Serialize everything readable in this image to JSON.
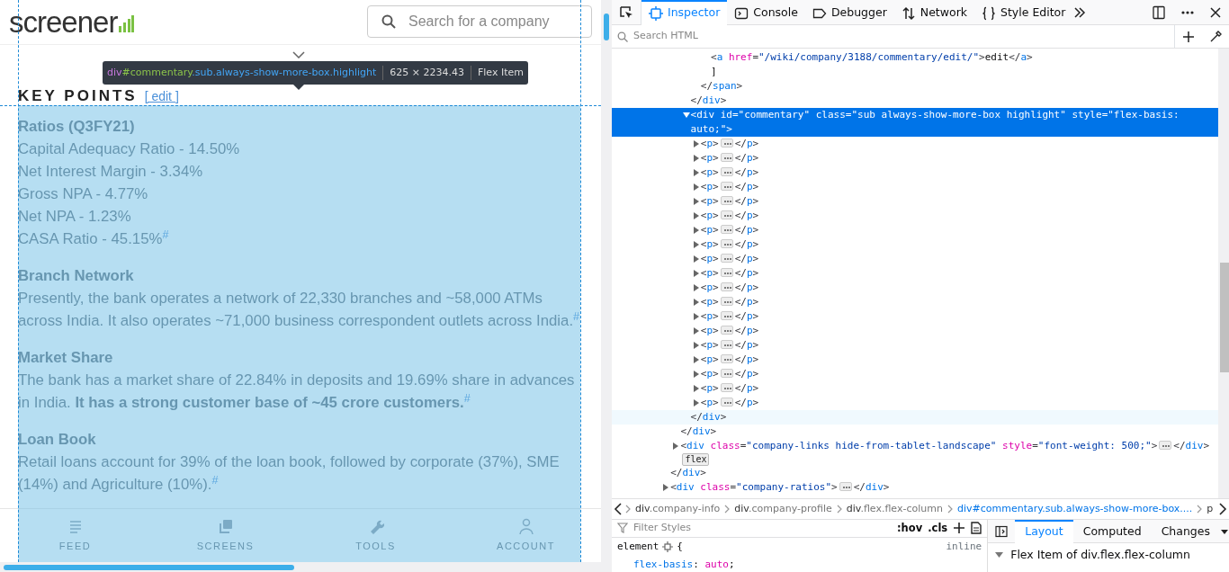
{
  "page": {
    "logo": "screener",
    "search": {
      "placeholder": "Search for a company"
    },
    "key_points": {
      "title": "KEY POINTS",
      "edit_link": "[ edit ]"
    },
    "sections": [
      {
        "heading": "Ratios (Q3FY21)",
        "lines": [
          "Capital Adequacy Ratio - 14.50%",
          "Net Interest Margin - 3.34%",
          "Gross NPA - 4.77%",
          "Net NPA - 1.23%",
          "CASA Ratio - 45.15%$^{#}$"
        ]
      },
      {
        "heading": "Branch Network",
        "lines": [
          "Presently, the bank operates a network of 22,330 branches and ~58,000 ATMs across India. It also operates ~71,000 business correspondent outlets across India.$^{#}$"
        ]
      },
      {
        "heading": "Market Share",
        "lines": [
          "The bank has a market share of 22.84% in deposits and 19.69% share in advances in India. **It has a strong customer base of ~45 crore customers.**$^{#}$"
        ]
      },
      {
        "heading": "Loan Book",
        "lines": [
          "Retail loans account for 39% of the loan book, followed by corporate (37%), SME (14%) and Agriculture (10%).$^{#}$"
        ]
      }
    ],
    "bottom_nav": [
      {
        "kind": "feed",
        "label": "FEED"
      },
      {
        "kind": "screens",
        "label": "SCREENS"
      },
      {
        "kind": "tools",
        "label": "TOOLS"
      },
      {
        "kind": "account",
        "label": "ACCOUNT"
      }
    ],
    "highlight": {
      "tag": "div",
      "id": "#commentary",
      "classes": ".sub.always-show-more-box.highlight",
      "size": "625 × 2234.43",
      "role": "Flex Item"
    }
  },
  "devtools": {
    "tabs": [
      {
        "kind": "inspector",
        "label": "Inspector",
        "selected": true
      },
      {
        "kind": "console",
        "label": "Console",
        "selected": false
      },
      {
        "kind": "debugger",
        "label": "Debugger",
        "selected": false
      },
      {
        "kind": "network",
        "label": "Network",
        "selected": false
      },
      {
        "kind": "style",
        "label": "Style Editor",
        "selected": false
      }
    ],
    "search": {
      "placeholder": "Search HTML"
    },
    "tree": [
      {
        "children": [
          {
            "children": [
              {
                "children": [
                  {
                    "children": [
                      {
                        "children": [
                          {
                            "text": "<a href=\"/wiki/company/3188/commentary/edit/\">edit</a>"
                          },
                          {
                            "text": "]"
                          }
                        ]
                      },
                      {
                        "text": "</span>"
                      }
                    ]
                  },
                  {
                    "text": "</div>"
                  },
                  {
                    "text": "<div id=\"commentary\" class=\"sub always-show-more-box highlight\" style=\"flex-basis: auto;\">",
                    "selected": true,
                    "expanded": true,
                    "close": "</div>",
                    "close_hovered": true,
                    "children": [
                      {
                        "text": "<p>",
                        "close": "</p>",
                        "expanded": false
                      },
                      {
                        "text": "<p>",
                        "close": "</p>",
                        "expanded": false
                      },
                      {
                        "text": "<p>",
                        "close": "</p>",
                        "expanded": false
                      },
                      {
                        "text": "<p>",
                        "close": "</p>",
                        "expanded": false
                      },
                      {
                        "text": "<p>",
                        "close": "</p>",
                        "expanded": false
                      },
                      {
                        "text": "<p>",
                        "close": "</p>",
                        "expanded": false
                      },
                      {
                        "text": "<p>",
                        "close": "</p>",
                        "expanded": false
                      },
                      {
                        "text": "<p>",
                        "close": "</p>",
                        "expanded": false
                      },
                      {
                        "text": "<p>",
                        "close": "</p>",
                        "expanded": false
                      },
                      {
                        "text": "<p>",
                        "close": "</p>",
                        "expanded": false
                      },
                      {
                        "text": "<p>",
                        "close": "</p>",
                        "expanded": false
                      },
                      {
                        "text": "<p>",
                        "close": "</p>",
                        "expanded": false
                      },
                      {
                        "text": "<p>",
                        "close": "</p>",
                        "expanded": false
                      },
                      {
                        "text": "<p>",
                        "close": "</p>",
                        "expanded": false
                      },
                      {
                        "text": "<p>",
                        "close": "</p>",
                        "expanded": false
                      },
                      {
                        "text": "<p>",
                        "close": "</p>",
                        "expanded": false
                      },
                      {
                        "text": "<p>",
                        "close": "</p>",
                        "expanded": false
                      },
                      {
                        "text": "<p>",
                        "close": "</p>",
                        "expanded": false
                      },
                      {
                        "text": "<p>",
                        "close": "</p>",
                        "expanded": false
                      }
                    ]
                  }
                ]
              },
              {
                "text": "</div>"
              },
              {
                "text": "<div class=\"company-links hide-from-tablet-landscape\" style=\"font-weight: 500;\">",
                "close": "</div>",
                "expanded": false,
                "badge": "flex"
              }
            ]
          },
          {
            "text": "</div>"
          },
          {
            "text": "<div class=\"company-ratios\">",
            "close": "</div>",
            "expanded": false
          }
        ]
      }
    ],
    "breadcrumbs": [
      {
        "tag": "div",
        "rest": ".company-info",
        "selected": false
      },
      {
        "tag": "div",
        "rest": ".company-profile",
        "selected": false
      },
      {
        "tag": "div",
        "rest": ".flex.flex-column",
        "selected": false
      },
      {
        "tag": "div",
        "rest": "#commentary.sub.always-show-more-box....",
        "selected": true
      },
      {
        "tag": "p",
        "selected": false
      }
    ],
    "rules": {
      "filter_placeholder": "Filter Styles",
      "hov": ":hov",
      "cls": ".cls",
      "selector": "element",
      "open_brace": "{",
      "source": "inline",
      "property": "flex-basis",
      "colon": ":",
      "value": "auto",
      "semicolon": ";"
    },
    "side_tabs": [
      {
        "label": "Layout",
        "selected": true
      },
      {
        "label": "Computed",
        "selected": false
      },
      {
        "label": "Changes",
        "selected": false
      }
    ],
    "flex_item_title": "Flex Item of div.flex.flex-column"
  }
}
